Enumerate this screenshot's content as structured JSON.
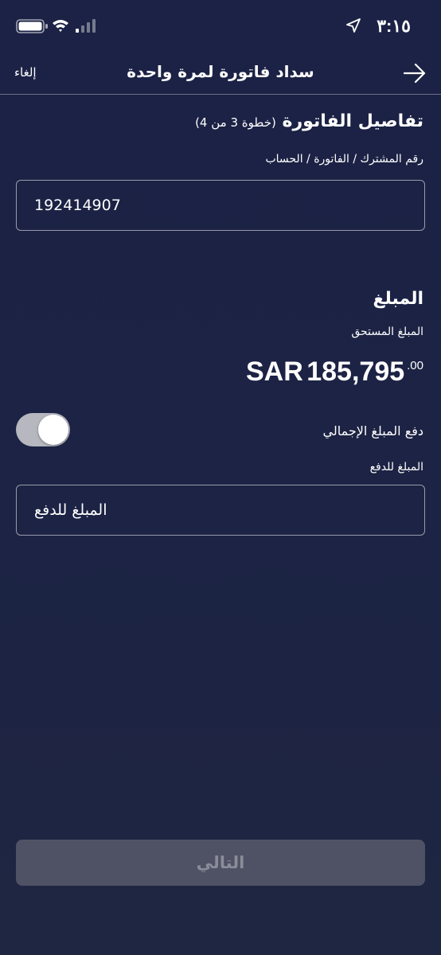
{
  "status_bar": {
    "time": "٣:١٥",
    "icons": [
      "location-arrow-icon",
      "battery-icon",
      "wifi-icon",
      "cellular-signal-icon"
    ]
  },
  "nav": {
    "title": "سداد فاتورة لمرة واحدة",
    "cancel_label": "إلغاء",
    "back_icon": "arrow-right-icon"
  },
  "invoice_details": {
    "heading": "تفاصيل الفاتورة",
    "step_note": "(خطوة 3 من 4)",
    "account_label": "رقم المشترك / الفاتورة / الحساب",
    "account_value": "192414907"
  },
  "amount_section": {
    "heading": "المبلغ",
    "due_label": "المبلغ المستحق",
    "currency": "SAR",
    "amount_main": "185,795",
    "amount_decimals": ".00",
    "pay_total_label": "دفع المبلغ الإجمالي",
    "pay_total_toggle_on": false,
    "pay_amount_label": "المبلغ للدفع",
    "pay_amount_placeholder": "المبلغ للدفع"
  },
  "footer": {
    "next_label": "التالي",
    "next_enabled": false
  },
  "colors": {
    "background": "#1c2344",
    "button_disabled_bg": "#4f5264",
    "button_disabled_text": "#8a8c99",
    "toggle_off": "#b6b7bf"
  }
}
